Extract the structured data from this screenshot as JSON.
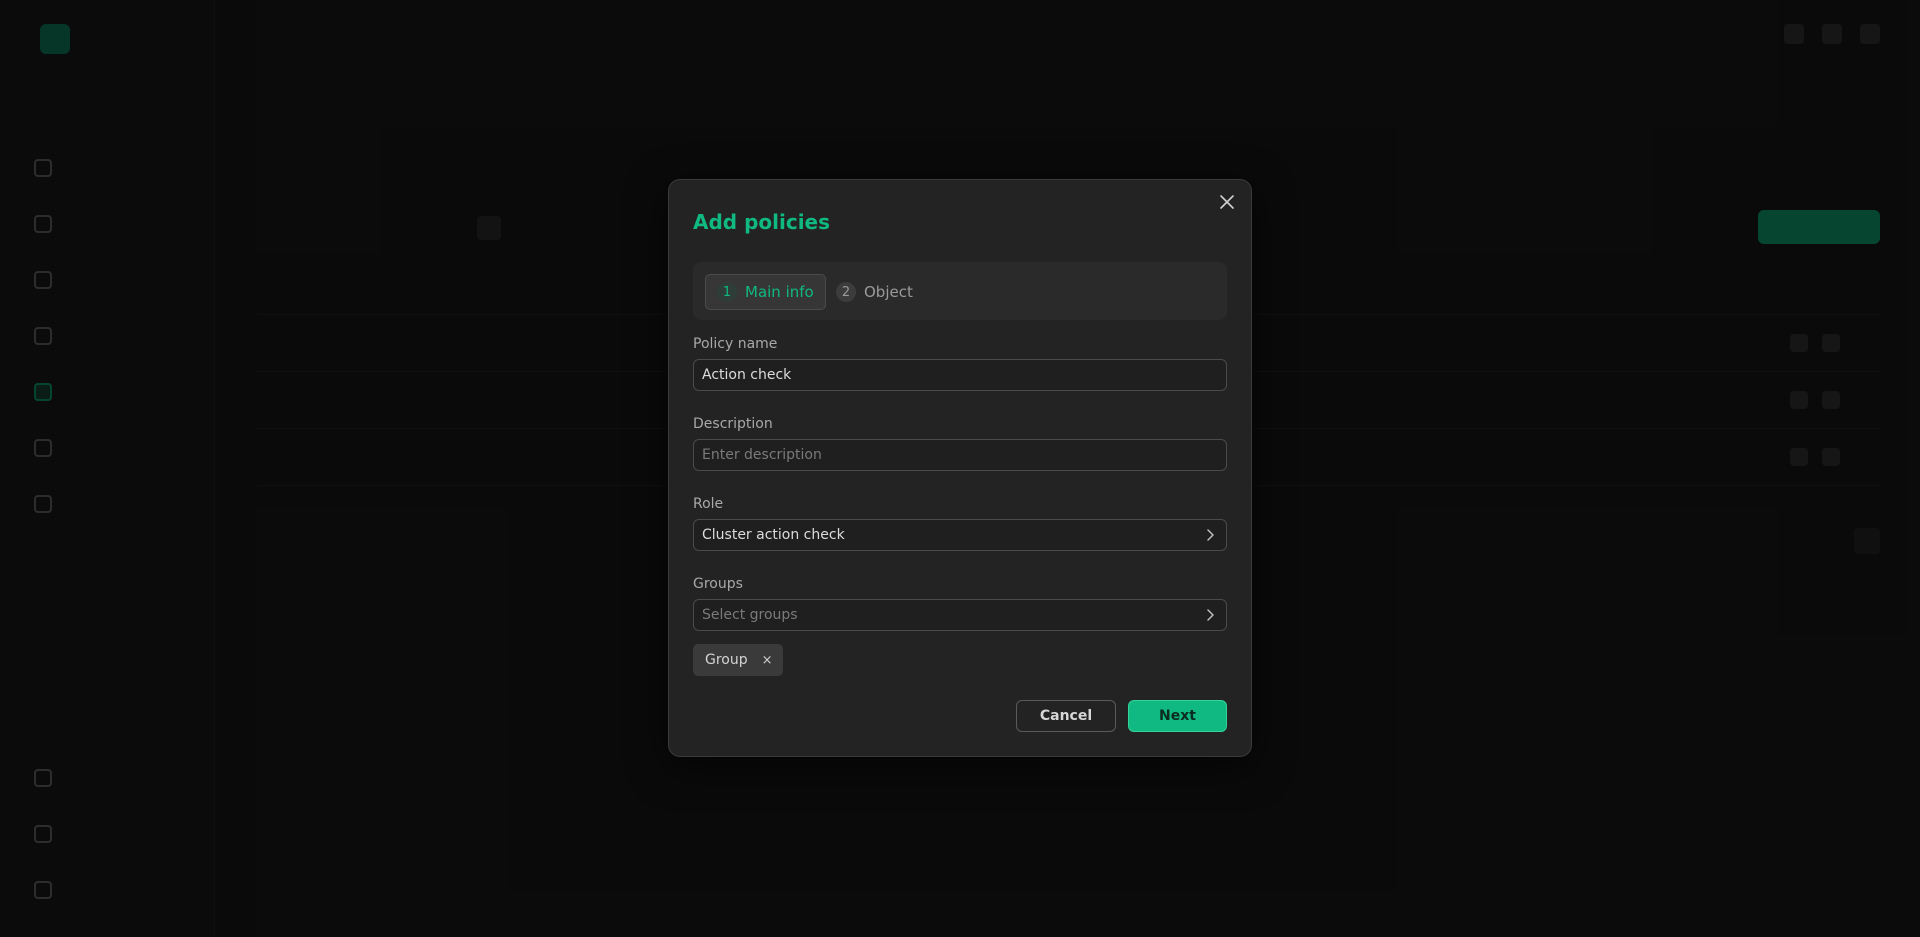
{
  "modal": {
    "title": "Add policies",
    "steps": [
      {
        "number": "1",
        "label": "Main info",
        "active": true
      },
      {
        "number": "2",
        "label": "Object",
        "active": false
      }
    ],
    "fields": {
      "policy_name": {
        "label": "Policy name",
        "value": "Action check"
      },
      "description": {
        "label": "Description",
        "placeholder": "Enter description",
        "value": ""
      },
      "role": {
        "label": "Role",
        "value": "Cluster action check"
      },
      "groups": {
        "label": "Groups",
        "placeholder": "Select groups",
        "selected": [
          "Group"
        ]
      }
    },
    "buttons": {
      "cancel": "Cancel",
      "next": "Next"
    }
  },
  "colors": {
    "accent": "#10b981",
    "modal_bg": "#232323",
    "overlay": "rgba(0,0,0,0.62)"
  },
  "icons": {
    "close": "close-icon",
    "chevron": "chevron-right-icon",
    "chip_remove": "×"
  }
}
